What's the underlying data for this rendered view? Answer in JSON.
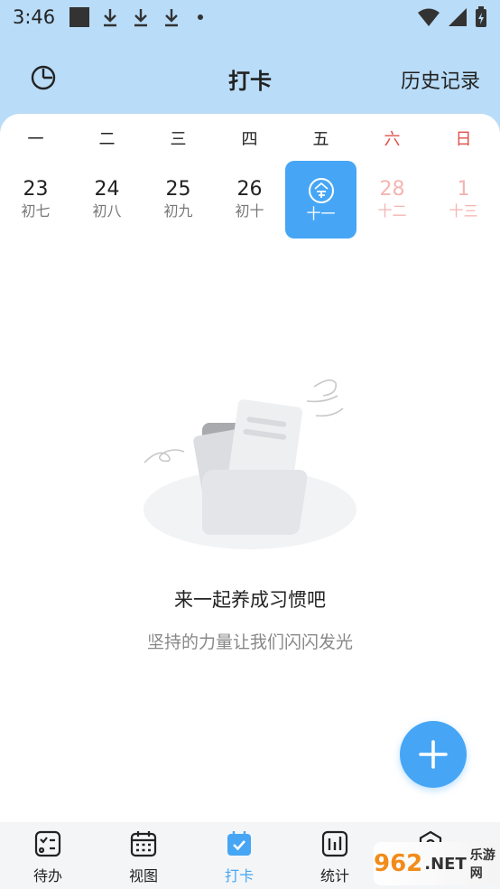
{
  "status_bar": {
    "time": "3:46"
  },
  "header": {
    "title": "打卡",
    "history_label": "历史记录"
  },
  "calendar": {
    "weekdays": [
      "一",
      "二",
      "三",
      "四",
      "五",
      "六",
      "日"
    ],
    "days": [
      {
        "num": "23",
        "lunar": "初七"
      },
      {
        "num": "24",
        "lunar": "初八"
      },
      {
        "num": "25",
        "lunar": "初九"
      },
      {
        "num": "26",
        "lunar": "初十"
      },
      {
        "num": "",
        "lunar": "十一",
        "today_icon": "today-icon"
      },
      {
        "num": "28",
        "lunar": "十二"
      },
      {
        "num": "1",
        "lunar": "十三"
      }
    ]
  },
  "empty_state": {
    "title": "来一起养成习惯吧",
    "subtitle": "坚持的力量让我们闪闪发光"
  },
  "bottom_nav": {
    "items": [
      {
        "label": "待办",
        "icon": "todo-list-icon"
      },
      {
        "label": "视图",
        "icon": "calendar-view-icon"
      },
      {
        "label": "打卡",
        "icon": "checkin-icon"
      },
      {
        "label": "统计",
        "icon": "stats-icon"
      },
      {
        "label": "",
        "icon": "settings-icon"
      }
    ]
  },
  "watermark": {
    "brand": "962",
    "suffix": ".NET",
    "text": "乐游网"
  },
  "colors": {
    "accent": "#46a6f5",
    "header_bg": "#b9dcf8",
    "weekend": "#e0504a"
  }
}
